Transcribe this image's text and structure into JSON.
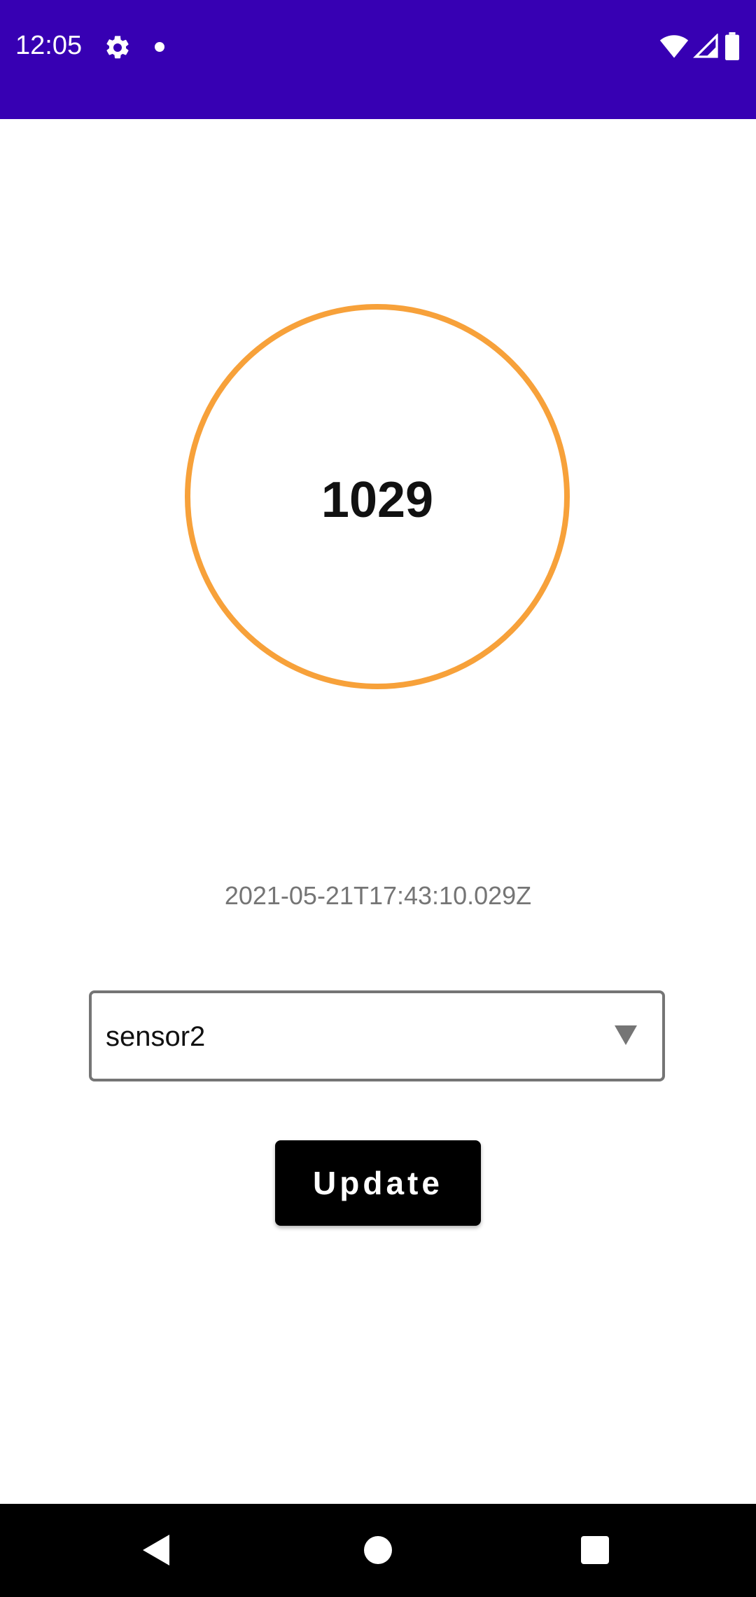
{
  "status_bar": {
    "time": "12:05",
    "background": "#3700b3",
    "icons": [
      "gear-icon",
      "notification-dot-icon",
      "wifi-icon",
      "signal-icon",
      "battery-icon"
    ]
  },
  "gauge": {
    "value": "1029",
    "ring_color": "#f7a13a"
  },
  "timestamp": "2021-05-21T17:43:10.029Z",
  "sensor_select": {
    "selected": "sensor2"
  },
  "update_button": {
    "label": "Update"
  },
  "nav_bar": {
    "icons": [
      "back-icon",
      "home-icon",
      "recents-icon"
    ]
  }
}
